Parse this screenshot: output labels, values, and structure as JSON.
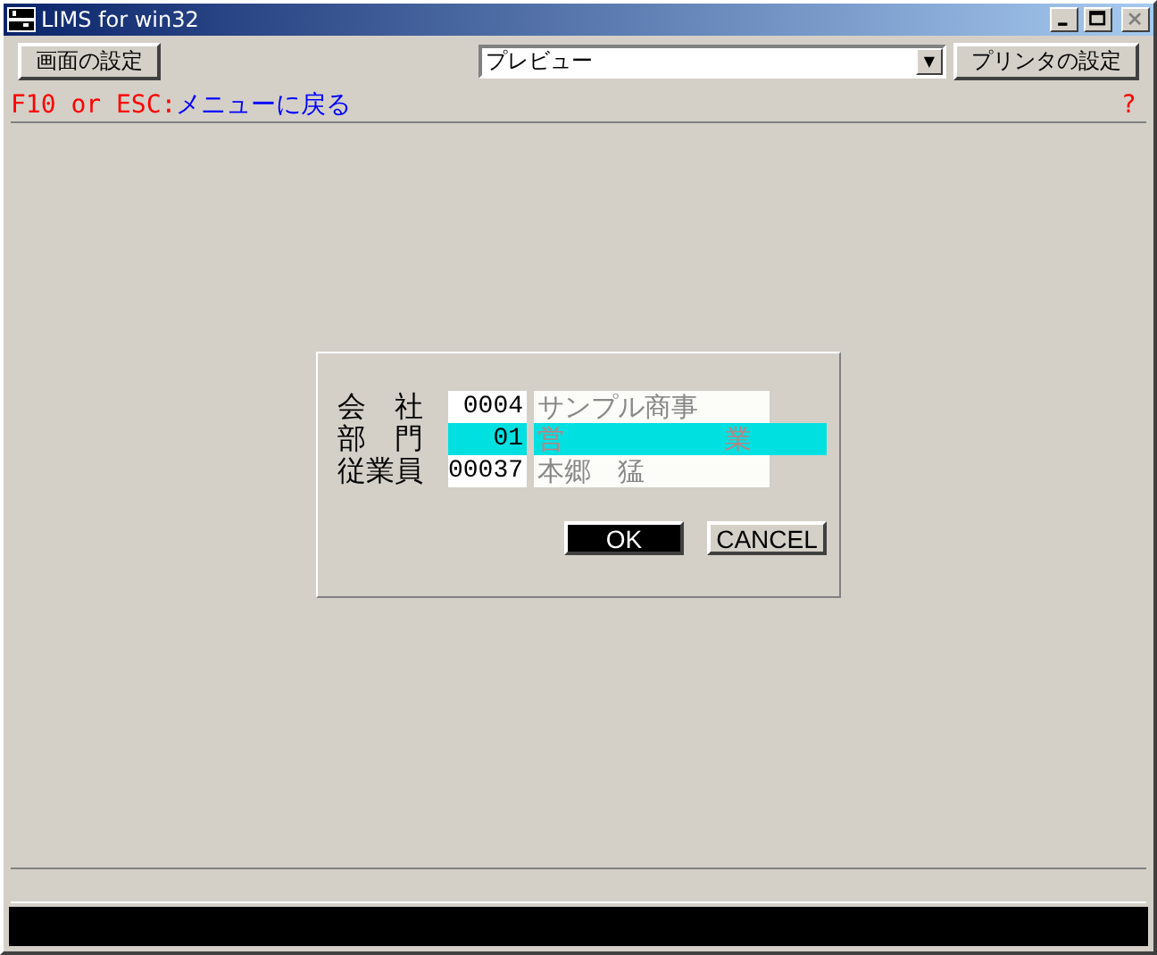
{
  "window": {
    "title": "LIMS for win32"
  },
  "toolbar": {
    "screen_settings": "画面の設定",
    "output_select": {
      "value": "プレビュー",
      "arrow": "▼"
    },
    "printer_settings": "プリンタの設定"
  },
  "hint": {
    "keys": "F10 or ESC:",
    "action": "メニューに戻る",
    "help": "?"
  },
  "dialog": {
    "rows": [
      {
        "label": "会　社",
        "code": "0004",
        "name": "サンプル商事",
        "selected": false
      },
      {
        "label": "部　門",
        "code": "01",
        "name": "営　　　　　　業",
        "selected": true
      },
      {
        "label": "従業員",
        "code": "00037",
        "name": "本郷　猛",
        "selected": false
      }
    ],
    "buttons": [
      {
        "label": "OK",
        "selected": true
      },
      {
        "label": "CANCEL",
        "selected": false
      }
    ]
  }
}
